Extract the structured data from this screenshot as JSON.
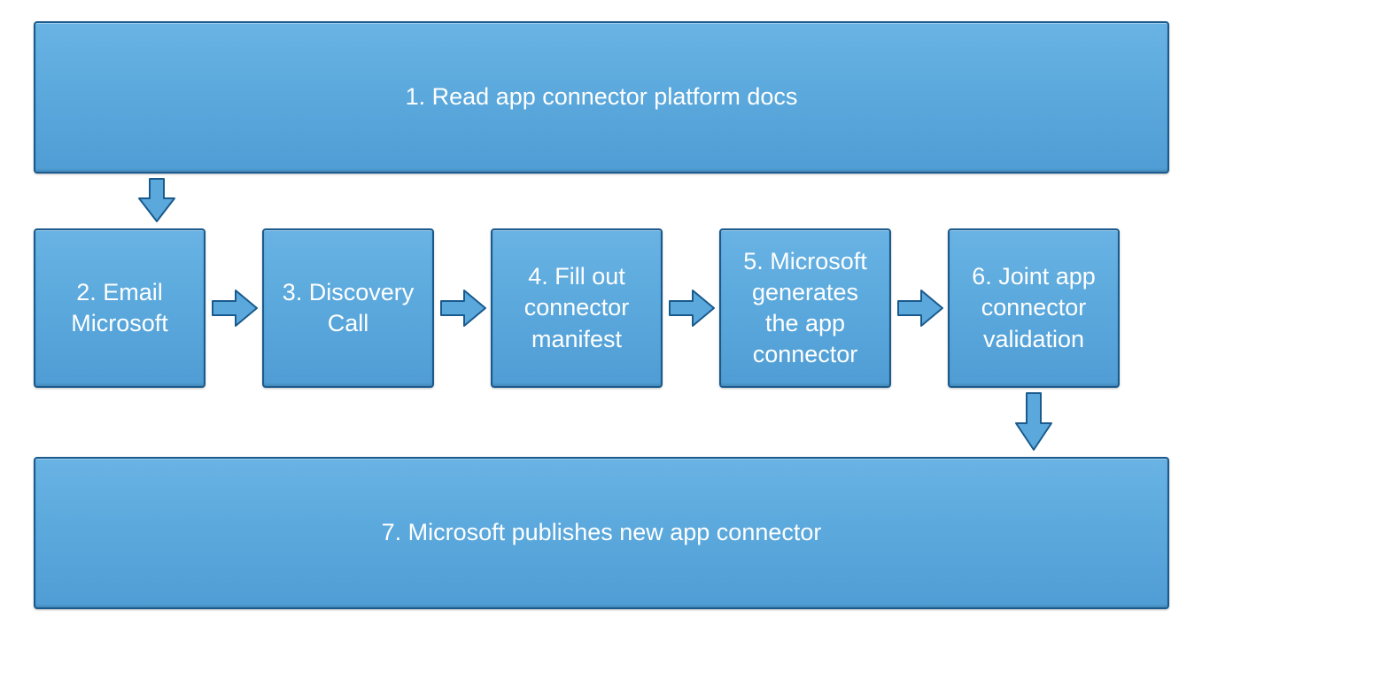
{
  "steps": {
    "s1": "1. Read app connector platform docs",
    "s2": "2. Email Microsoft",
    "s3": "3. Discovery Call",
    "s4": "4. Fill out connector manifest",
    "s5": "5. Microsoft generates the app connector",
    "s6": "6. Joint app connector validation",
    "s7": "7. Microsoft publishes new app connector"
  },
  "colors": {
    "boxFill": "#5aa8dc",
    "boxBorder": "#1a5a8c",
    "arrowFill": "#5aa8dc",
    "arrowBorder": "#1a5a8c"
  }
}
